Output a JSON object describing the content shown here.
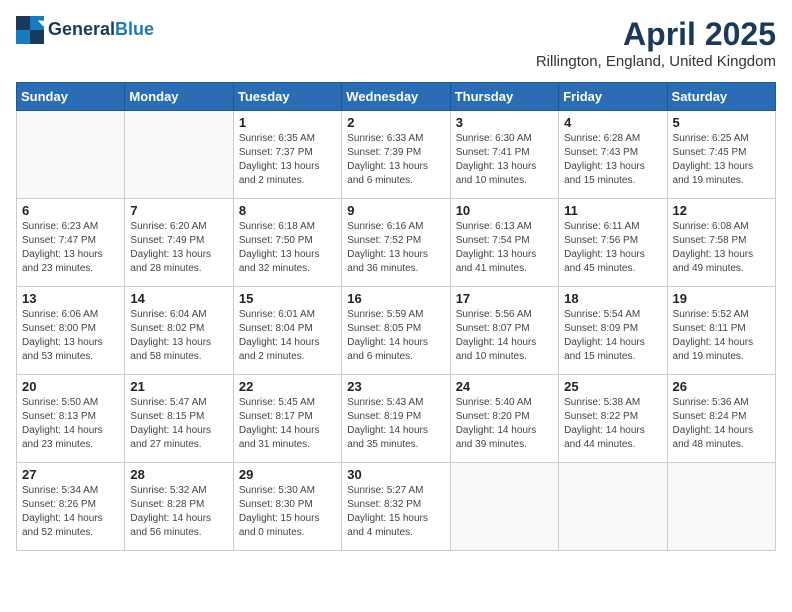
{
  "logo": {
    "line1": "General",
    "line2": "Blue"
  },
  "title": "April 2025",
  "location": "Rillington, England, United Kingdom",
  "days_of_week": [
    "Sunday",
    "Monday",
    "Tuesday",
    "Wednesday",
    "Thursday",
    "Friday",
    "Saturday"
  ],
  "weeks": [
    [
      {
        "day": "",
        "info": ""
      },
      {
        "day": "",
        "info": ""
      },
      {
        "day": "1",
        "info": "Sunrise: 6:35 AM\nSunset: 7:37 PM\nDaylight: 13 hours\nand 2 minutes."
      },
      {
        "day": "2",
        "info": "Sunrise: 6:33 AM\nSunset: 7:39 PM\nDaylight: 13 hours\nand 6 minutes."
      },
      {
        "day": "3",
        "info": "Sunrise: 6:30 AM\nSunset: 7:41 PM\nDaylight: 13 hours\nand 10 minutes."
      },
      {
        "day": "4",
        "info": "Sunrise: 6:28 AM\nSunset: 7:43 PM\nDaylight: 13 hours\nand 15 minutes."
      },
      {
        "day": "5",
        "info": "Sunrise: 6:25 AM\nSunset: 7:45 PM\nDaylight: 13 hours\nand 19 minutes."
      }
    ],
    [
      {
        "day": "6",
        "info": "Sunrise: 6:23 AM\nSunset: 7:47 PM\nDaylight: 13 hours\nand 23 minutes."
      },
      {
        "day": "7",
        "info": "Sunrise: 6:20 AM\nSunset: 7:49 PM\nDaylight: 13 hours\nand 28 minutes."
      },
      {
        "day": "8",
        "info": "Sunrise: 6:18 AM\nSunset: 7:50 PM\nDaylight: 13 hours\nand 32 minutes."
      },
      {
        "day": "9",
        "info": "Sunrise: 6:16 AM\nSunset: 7:52 PM\nDaylight: 13 hours\nand 36 minutes."
      },
      {
        "day": "10",
        "info": "Sunrise: 6:13 AM\nSunset: 7:54 PM\nDaylight: 13 hours\nand 41 minutes."
      },
      {
        "day": "11",
        "info": "Sunrise: 6:11 AM\nSunset: 7:56 PM\nDaylight: 13 hours\nand 45 minutes."
      },
      {
        "day": "12",
        "info": "Sunrise: 6:08 AM\nSunset: 7:58 PM\nDaylight: 13 hours\nand 49 minutes."
      }
    ],
    [
      {
        "day": "13",
        "info": "Sunrise: 6:06 AM\nSunset: 8:00 PM\nDaylight: 13 hours\nand 53 minutes."
      },
      {
        "day": "14",
        "info": "Sunrise: 6:04 AM\nSunset: 8:02 PM\nDaylight: 13 hours\nand 58 minutes."
      },
      {
        "day": "15",
        "info": "Sunrise: 6:01 AM\nSunset: 8:04 PM\nDaylight: 14 hours\nand 2 minutes."
      },
      {
        "day": "16",
        "info": "Sunrise: 5:59 AM\nSunset: 8:05 PM\nDaylight: 14 hours\nand 6 minutes."
      },
      {
        "day": "17",
        "info": "Sunrise: 5:56 AM\nSunset: 8:07 PM\nDaylight: 14 hours\nand 10 minutes."
      },
      {
        "day": "18",
        "info": "Sunrise: 5:54 AM\nSunset: 8:09 PM\nDaylight: 14 hours\nand 15 minutes."
      },
      {
        "day": "19",
        "info": "Sunrise: 5:52 AM\nSunset: 8:11 PM\nDaylight: 14 hours\nand 19 minutes."
      }
    ],
    [
      {
        "day": "20",
        "info": "Sunrise: 5:50 AM\nSunset: 8:13 PM\nDaylight: 14 hours\nand 23 minutes."
      },
      {
        "day": "21",
        "info": "Sunrise: 5:47 AM\nSunset: 8:15 PM\nDaylight: 14 hours\nand 27 minutes."
      },
      {
        "day": "22",
        "info": "Sunrise: 5:45 AM\nSunset: 8:17 PM\nDaylight: 14 hours\nand 31 minutes."
      },
      {
        "day": "23",
        "info": "Sunrise: 5:43 AM\nSunset: 8:19 PM\nDaylight: 14 hours\nand 35 minutes."
      },
      {
        "day": "24",
        "info": "Sunrise: 5:40 AM\nSunset: 8:20 PM\nDaylight: 14 hours\nand 39 minutes."
      },
      {
        "day": "25",
        "info": "Sunrise: 5:38 AM\nSunset: 8:22 PM\nDaylight: 14 hours\nand 44 minutes."
      },
      {
        "day": "26",
        "info": "Sunrise: 5:36 AM\nSunset: 8:24 PM\nDaylight: 14 hours\nand 48 minutes."
      }
    ],
    [
      {
        "day": "27",
        "info": "Sunrise: 5:34 AM\nSunset: 8:26 PM\nDaylight: 14 hours\nand 52 minutes."
      },
      {
        "day": "28",
        "info": "Sunrise: 5:32 AM\nSunset: 8:28 PM\nDaylight: 14 hours\nand 56 minutes."
      },
      {
        "day": "29",
        "info": "Sunrise: 5:30 AM\nSunset: 8:30 PM\nDaylight: 15 hours\nand 0 minutes."
      },
      {
        "day": "30",
        "info": "Sunrise: 5:27 AM\nSunset: 8:32 PM\nDaylight: 15 hours\nand 4 minutes."
      },
      {
        "day": "",
        "info": ""
      },
      {
        "day": "",
        "info": ""
      },
      {
        "day": "",
        "info": ""
      }
    ]
  ]
}
